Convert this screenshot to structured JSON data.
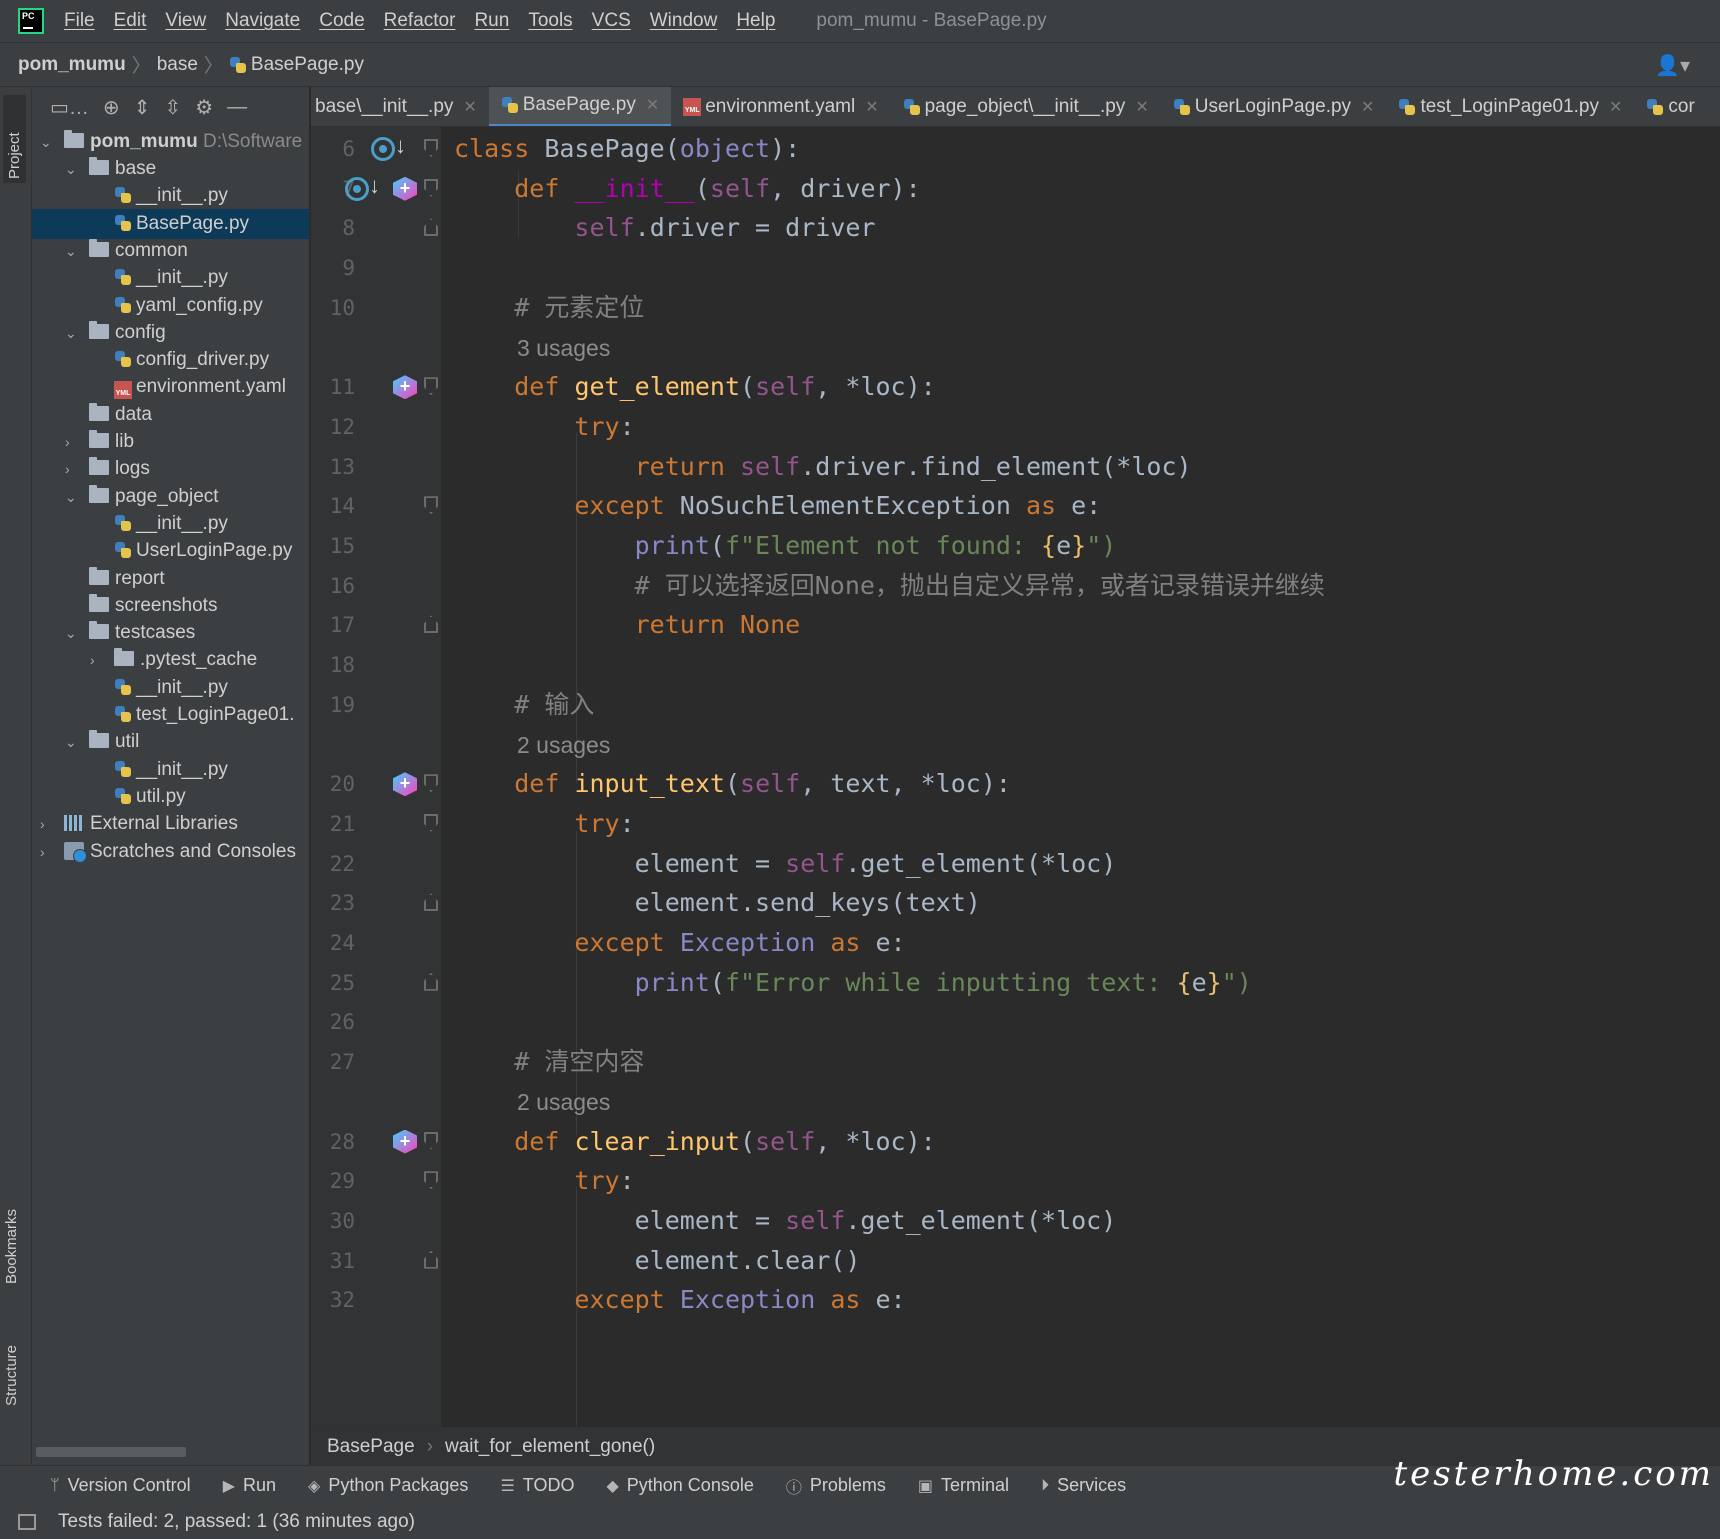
{
  "menubar": {
    "items": [
      "File",
      "Edit",
      "View",
      "Navigate",
      "Code",
      "Refactor",
      "Run",
      "Tools",
      "VCS",
      "Window",
      "Help"
    ],
    "title": "pom_mumu - BasePage.py"
  },
  "breadcrumb": {
    "root": "pom_mumu",
    "folder": "base",
    "file": "BasePage.py"
  },
  "side_tabs": {
    "project": "Project",
    "bookmarks": "Bookmarks",
    "structure": "Structure"
  },
  "project_tree": {
    "root_name": "pom_mumu",
    "root_path": "D:\\Software",
    "rows": [
      "base",
      "__init__.py",
      "BasePage.py",
      "common",
      "__init__.py",
      "yaml_config.py",
      "config",
      "config_driver.py",
      "environment.yaml",
      "data",
      "lib",
      "logs",
      "page_object",
      "__init__.py",
      "UserLoginPage.py",
      "report",
      "screenshots",
      "testcases",
      ".pytest_cache",
      "__init__.py",
      "test_LoginPage01.",
      "util",
      "__init__.py",
      "util.py",
      "External Libraries",
      "Scratches and Consoles"
    ]
  },
  "tabs": [
    "base\\__init__.py",
    "BasePage.py",
    "environment.yaml",
    "page_object\\__init__.py",
    "UserLoginPage.py",
    "test_LoginPage01.py",
    "cor"
  ],
  "editor": {
    "line_numbers": [
      "6",
      "7",
      "8",
      "9",
      "10",
      "11",
      "12",
      "13",
      "14",
      "15",
      "16",
      "17",
      "18",
      "19",
      "20",
      "21",
      "22",
      "23",
      "24",
      "25",
      "26",
      "27",
      "28",
      "29",
      "30",
      "31",
      "32"
    ],
    "usages": [
      "3 usages",
      "2 usages",
      "2 usages"
    ],
    "comments": [
      "# 元素定位",
      "# 可以选择返回None，抛出自定义异常，或者记录错误并继续",
      "# 输入",
      "# 清空内容"
    ]
  },
  "editor_breadcrumb": {
    "class": "BasePage",
    "method": "wait_for_element_gone()"
  },
  "tool_windows": [
    "Version Control",
    "Run",
    "Python Packages",
    "TODO",
    "Python Console",
    "Problems",
    "Terminal",
    "Services"
  ],
  "status": {
    "text": "Tests failed: 2, passed: 1 (36 minutes ago)"
  },
  "watermark": "testerhome.com",
  "colors": {
    "keyword": "#cc7832",
    "function": "#ffc66d",
    "self": "#94558d",
    "string": "#6a8759",
    "comment": "#808080",
    "background": "#2b2b2b"
  }
}
